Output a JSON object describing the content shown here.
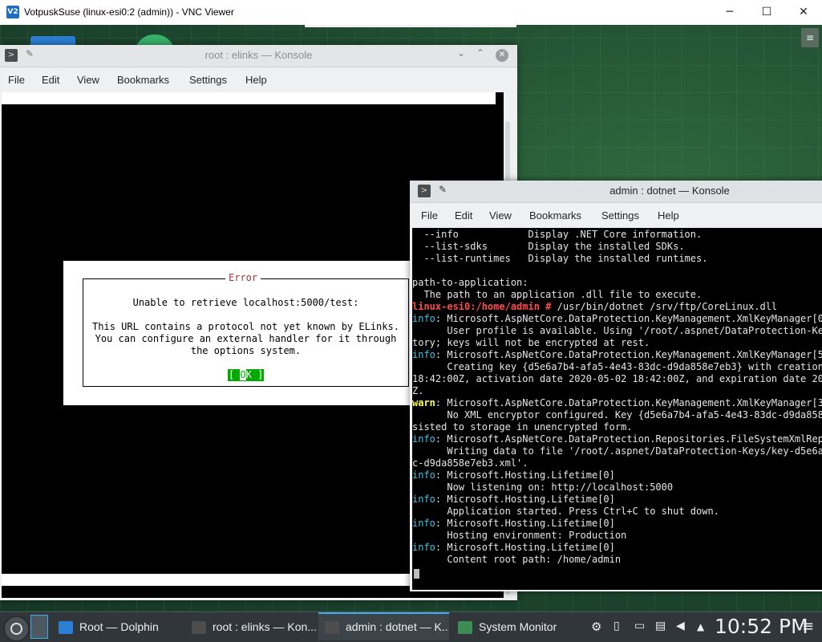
{
  "vnc": {
    "title": "VotpuskSuse (linux-esi0:2 (admin)) - VNC Viewer",
    "logo": "V2",
    "minimize": "─",
    "maximize": "☐",
    "close": "✕"
  },
  "desktop": {
    "menu_icon": "≡"
  },
  "konsole_back": {
    "title": "root : elinks — Konsole",
    "menu": [
      "File",
      "Edit",
      "View",
      "Bookmarks",
      "Settings",
      "Help"
    ],
    "dialog": {
      "title": "Error",
      "line1": "Unable to retrieve localhost:5000/test:",
      "line2": "This URL contains a protocol not yet known by ELinks.",
      "line3": "You can configure an external handler for it through",
      "line4": "the options system.",
      "ok_prefix": "[ ",
      "ok_cursor": "O",
      "ok_rest": "K ]"
    }
  },
  "konsole_front": {
    "title": "admin : dotnet — Konsole",
    "menu": [
      "File",
      "Edit",
      "View",
      "Bookmarks",
      "Settings",
      "Help"
    ],
    "lines": [
      [
        {
          "t": "  --info            Display .NET Core information."
        }
      ],
      [
        {
          "t": "  --list-sdks       Display the installed SDKs."
        }
      ],
      [
        {
          "t": "  --list-runtimes   Display the installed runtimes."
        }
      ],
      [
        {
          "t": ""
        }
      ],
      [
        {
          "t": "path-to-application:"
        }
      ],
      [
        {
          "t": "  The path to an application .dll file to execute."
        }
      ],
      [
        {
          "t": "linux-esi0:/home/admin # ",
          "c": "c-red"
        },
        {
          "t": "/usr/bin/dotnet /srv/ftp/CoreLinux.dll"
        }
      ],
      [
        {
          "t": "info",
          "c": "c-info"
        },
        {
          "t": ": Microsoft.AspNetCore.DataProtection.KeyManagement.XmlKeyManager[0]"
        }
      ],
      [
        {
          "t": "      User profile is available. Using '/root/.aspnet/DataProtection-Keys"
        }
      ],
      [
        {
          "t": "tory; keys will not be encrypted at rest."
        }
      ],
      [
        {
          "t": "info",
          "c": "c-info"
        },
        {
          "t": ": Microsoft.AspNetCore.DataProtection.KeyManagement.XmlKeyManager[58]"
        }
      ],
      [
        {
          "t": "      Creating key {d5e6a7b4-afa5-4e43-83dc-d9da858e7eb3} with creation d"
        }
      ],
      [
        {
          "t": "18:42:00Z, activation date 2020-05-02 18:42:00Z, and expiration date 2020"
        }
      ],
      [
        {
          "t": "Z."
        }
      ],
      [
        {
          "t": "warn",
          "c": "c-warn"
        },
        {
          "t": ": Microsoft.AspNetCore.DataProtection.KeyManagement.XmlKeyManager[35]"
        }
      ],
      [
        {
          "t": "      No XML encryptor configured. Key {d5e6a7b4-afa5-4e43-83dc-d9da858e7"
        }
      ],
      [
        {
          "t": "sisted to storage in unencrypted form."
        }
      ],
      [
        {
          "t": "info",
          "c": "c-info"
        },
        {
          "t": ": Microsoft.AspNetCore.DataProtection.Repositories.FileSystemXmlRepos"
        }
      ],
      [
        {
          "t": "      Writing data to file '/root/.aspnet/DataProtection-Keys/key-d5e6a7b"
        }
      ],
      [
        {
          "t": "c-d9da858e7eb3.xml'."
        }
      ],
      [
        {
          "t": "info",
          "c": "c-info"
        },
        {
          "t": ": Microsoft.Hosting.Lifetime[0]"
        }
      ],
      [
        {
          "t": "      Now listening on: http://localhost:5000"
        }
      ],
      [
        {
          "t": "info",
          "c": "c-info"
        },
        {
          "t": ": Microsoft.Hosting.Lifetime[0]"
        }
      ],
      [
        {
          "t": "      Application started. Press Ctrl+C to shut down."
        }
      ],
      [
        {
          "t": "info",
          "c": "c-info"
        },
        {
          "t": ": Microsoft.Hosting.Lifetime[0]"
        }
      ],
      [
        {
          "t": "      Hosting environment: Production"
        }
      ],
      [
        {
          "t": "info",
          "c": "c-info"
        },
        {
          "t": ": Microsoft.Hosting.Lifetime[0]"
        }
      ],
      [
        {
          "t": "      Content root path: /home/admin"
        }
      ]
    ]
  },
  "taskbar": {
    "tasks": [
      {
        "label": "Root — Dolphin",
        "icon": "folder-icon"
      },
      {
        "label": "root : elinks — Kon...",
        "icon": "terminal-icon"
      },
      {
        "label": "admin : dotnet — K...",
        "icon": "terminal-icon"
      },
      {
        "label": "System Monitor",
        "icon": "monitor-icon"
      }
    ],
    "clock": "10:52 PM",
    "menu_icon": "≡"
  },
  "colors": {
    "accent": "#3daee9",
    "info": "#3fc4e0",
    "prompt": "#ff4d4d",
    "warn": "#ffff55",
    "ok_button": "#00aa00",
    "dialog_bg": "#ffffff"
  }
}
